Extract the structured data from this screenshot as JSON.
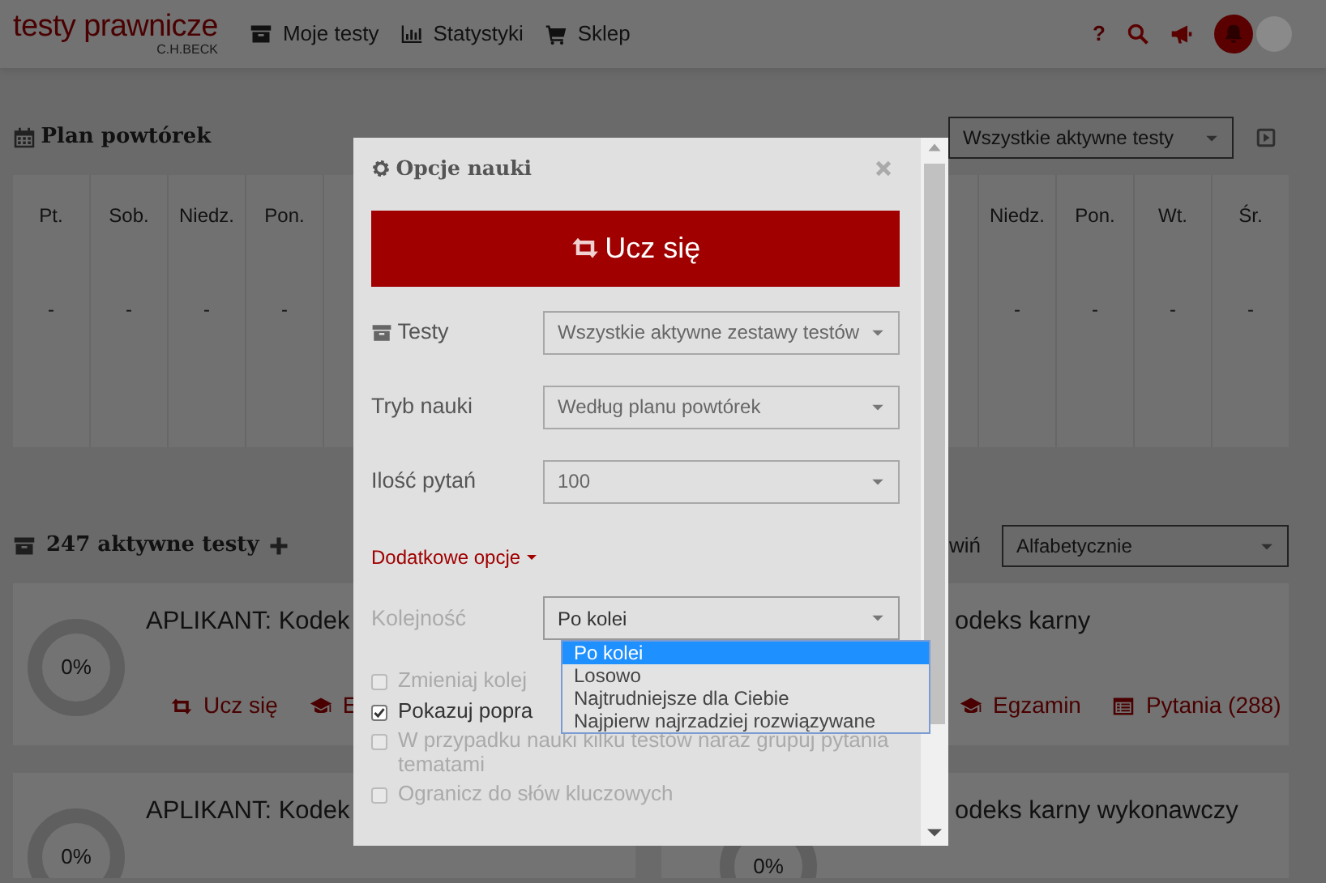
{
  "navbar": {
    "logo": "testy prawnicze",
    "logo_sub": "C.H.BECK",
    "links": [
      {
        "label": "Moje testy",
        "kind": "tests"
      },
      {
        "label": "Statystyki",
        "kind": "stats"
      },
      {
        "label": "Sklep",
        "kind": "shop"
      }
    ],
    "help": "?"
  },
  "plan": {
    "title": "Plan powtórek",
    "filter": "Wszystkie aktywne testy",
    "days_left": [
      {
        "day": "Pt.",
        "value": "-"
      },
      {
        "day": "Sob.",
        "value": "-"
      },
      {
        "day": "Niedz.",
        "value": "-"
      },
      {
        "day": "Pon.",
        "value": "-"
      }
    ],
    "days_right": [
      {
        "day": "Niedz.",
        "value": "-"
      },
      {
        "day": "Pon.",
        "value": "-"
      },
      {
        "day": "Wt.",
        "value": "-"
      },
      {
        "day": "Śr.",
        "value": "-"
      }
    ]
  },
  "tests_header": {
    "title": "247 aktywne testy",
    "collapse": "wiń",
    "sort": "Alfabetycznie"
  },
  "cards_left": [
    {
      "title": "APLIKANT: Kodek",
      "progress": "0%",
      "actions": [
        {
          "label": "Ucz się",
          "kind": "study"
        },
        {
          "label": "E",
          "kind": "exam"
        }
      ]
    },
    {
      "title": "APLIKANT: Kodek",
      "progress": "0%"
    }
  ],
  "cards_right": [
    {
      "title": "odeks karny",
      "actions": [
        {
          "label": "Egzamin",
          "kind": "exam"
        },
        {
          "label": "Pytania (288)",
          "kind": "questions"
        }
      ]
    },
    {
      "title": "odeks karny wykonawczy",
      "progress": "0%"
    }
  ],
  "modal": {
    "title": "Opcje nauki",
    "primary_button": "Ucz się",
    "fields": [
      {
        "label": "Testy",
        "kind": "archive",
        "value": "Wszystkie aktywne zestawy testów"
      },
      {
        "label": "Tryb nauki",
        "kind": "plain",
        "value": "Według planu powtórek"
      },
      {
        "label": "Ilość pytań",
        "kind": "plain",
        "value": "100"
      }
    ],
    "more_options": "Dodatkowe opcje",
    "order": {
      "label": "Kolejność",
      "disabled": true,
      "value": "Po kolei",
      "expanded": true,
      "options": [
        {
          "label": "Po kolei",
          "selected": true
        },
        {
          "label": "Losowo",
          "selected": false
        },
        {
          "label": "Najtrudniejsze dla Ciebie",
          "selected": false
        },
        {
          "label": "Najpierw najrzadziej rozwiązywane",
          "selected": false
        }
      ]
    },
    "checkboxes": [
      {
        "label": "Zmieniaj kolej",
        "checked": false,
        "disabled": true
      },
      {
        "label": "Pokazuj popra",
        "checked": true,
        "disabled": false
      },
      {
        "label": "W przypadku nauki kilku testów naraz grupuj pytania tematami",
        "checked": false,
        "disabled": true
      },
      {
        "label": "Ogranicz do słów kluczowych",
        "checked": false,
        "disabled": true
      }
    ]
  }
}
